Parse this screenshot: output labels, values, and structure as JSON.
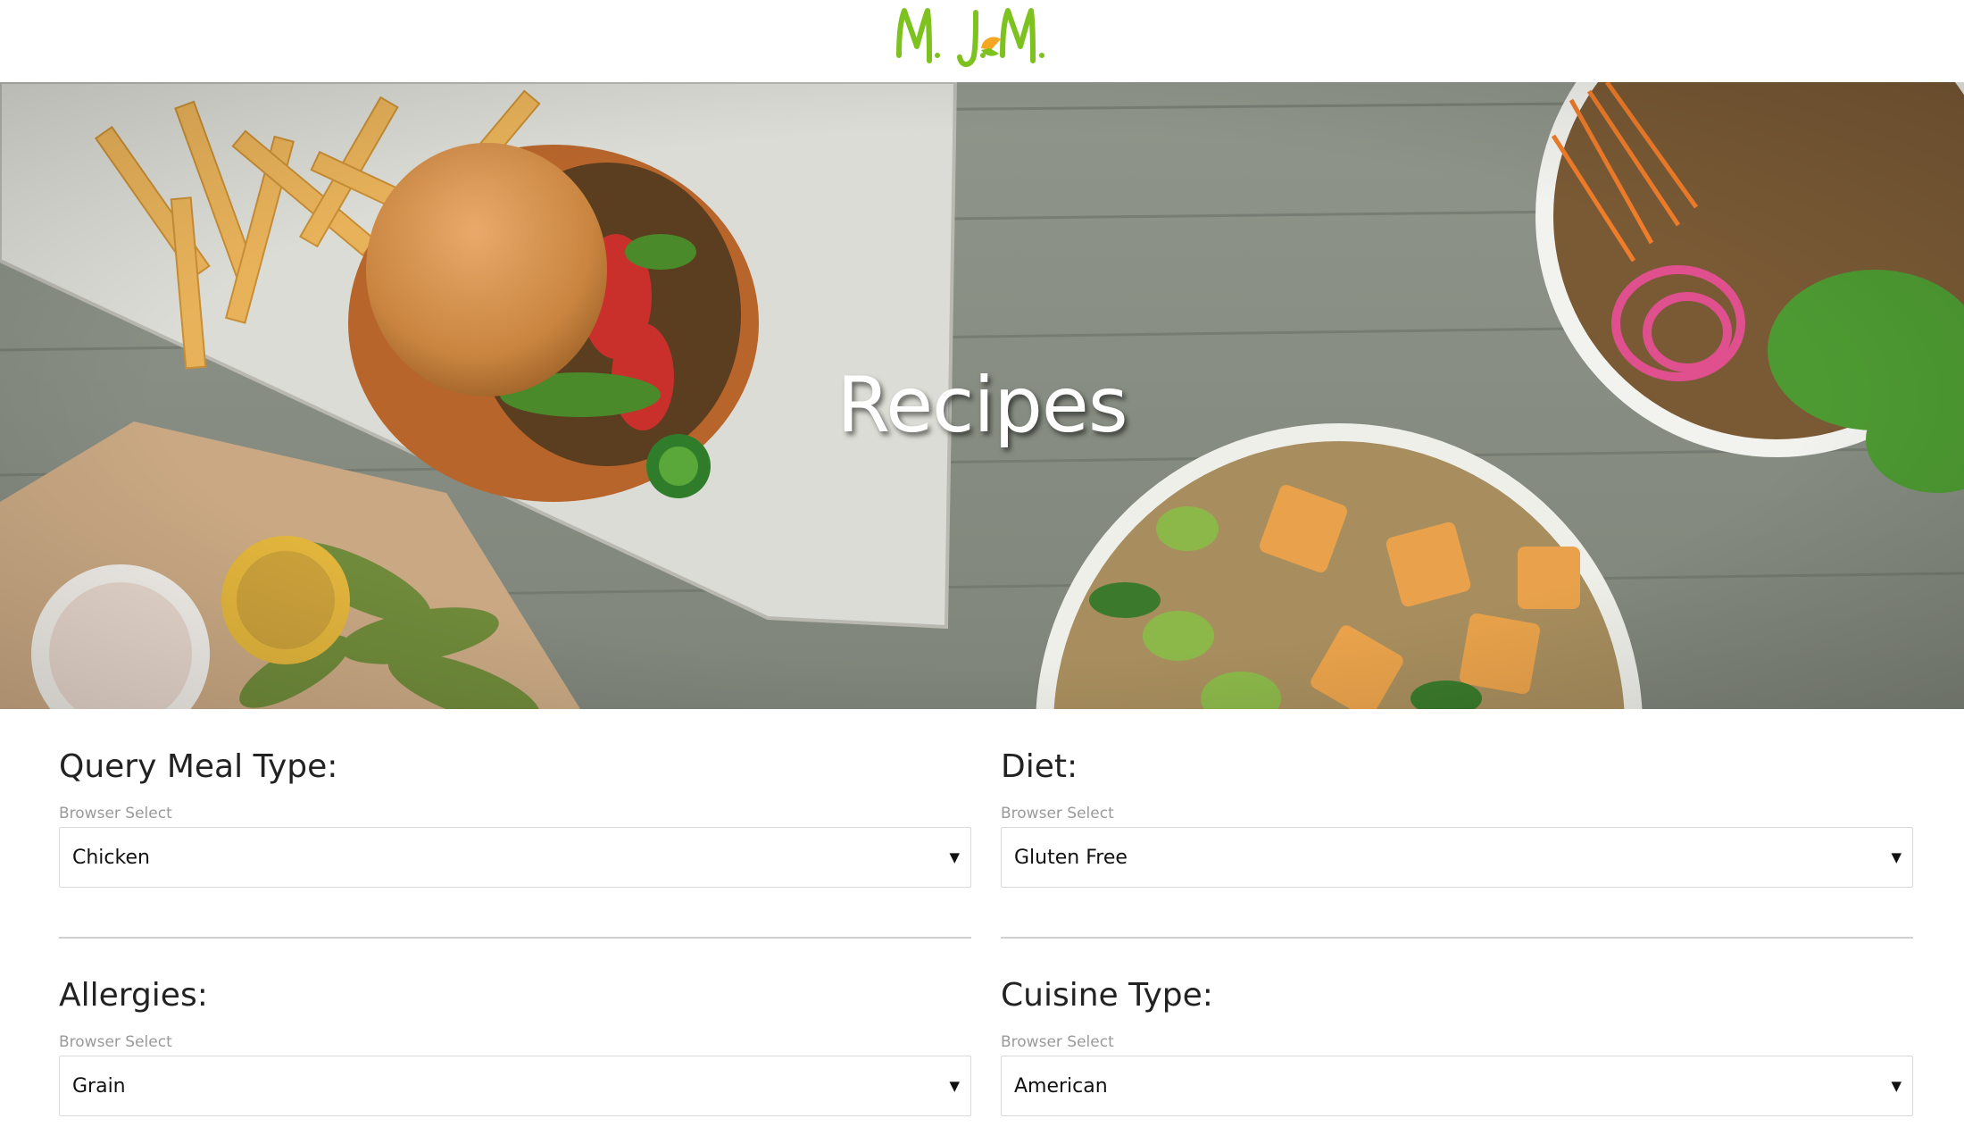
{
  "header": {
    "logo_text": "M. J. M.",
    "logo_color": "#7dc21e",
    "logo_accent_color": "#f5a623"
  },
  "hero": {
    "title": "Recipes"
  },
  "filters": [
    {
      "title": "Query Meal Type:",
      "hint": "Browser Select",
      "selected": "Chicken"
    },
    {
      "title": "Diet:",
      "hint": "Browser Select",
      "selected": "Gluten Free"
    },
    {
      "title": "Allergies:",
      "hint": "Browser Select",
      "selected": "Grain"
    },
    {
      "title": "Cuisine Type:",
      "hint": "Browser Select",
      "selected": "American"
    }
  ],
  "icons": {
    "dropdown": "triangle-down-icon"
  },
  "colors": {
    "accent": "#7dc21e",
    "text": "#222222",
    "hint": "#9a9a9a",
    "border": "#dadada"
  }
}
